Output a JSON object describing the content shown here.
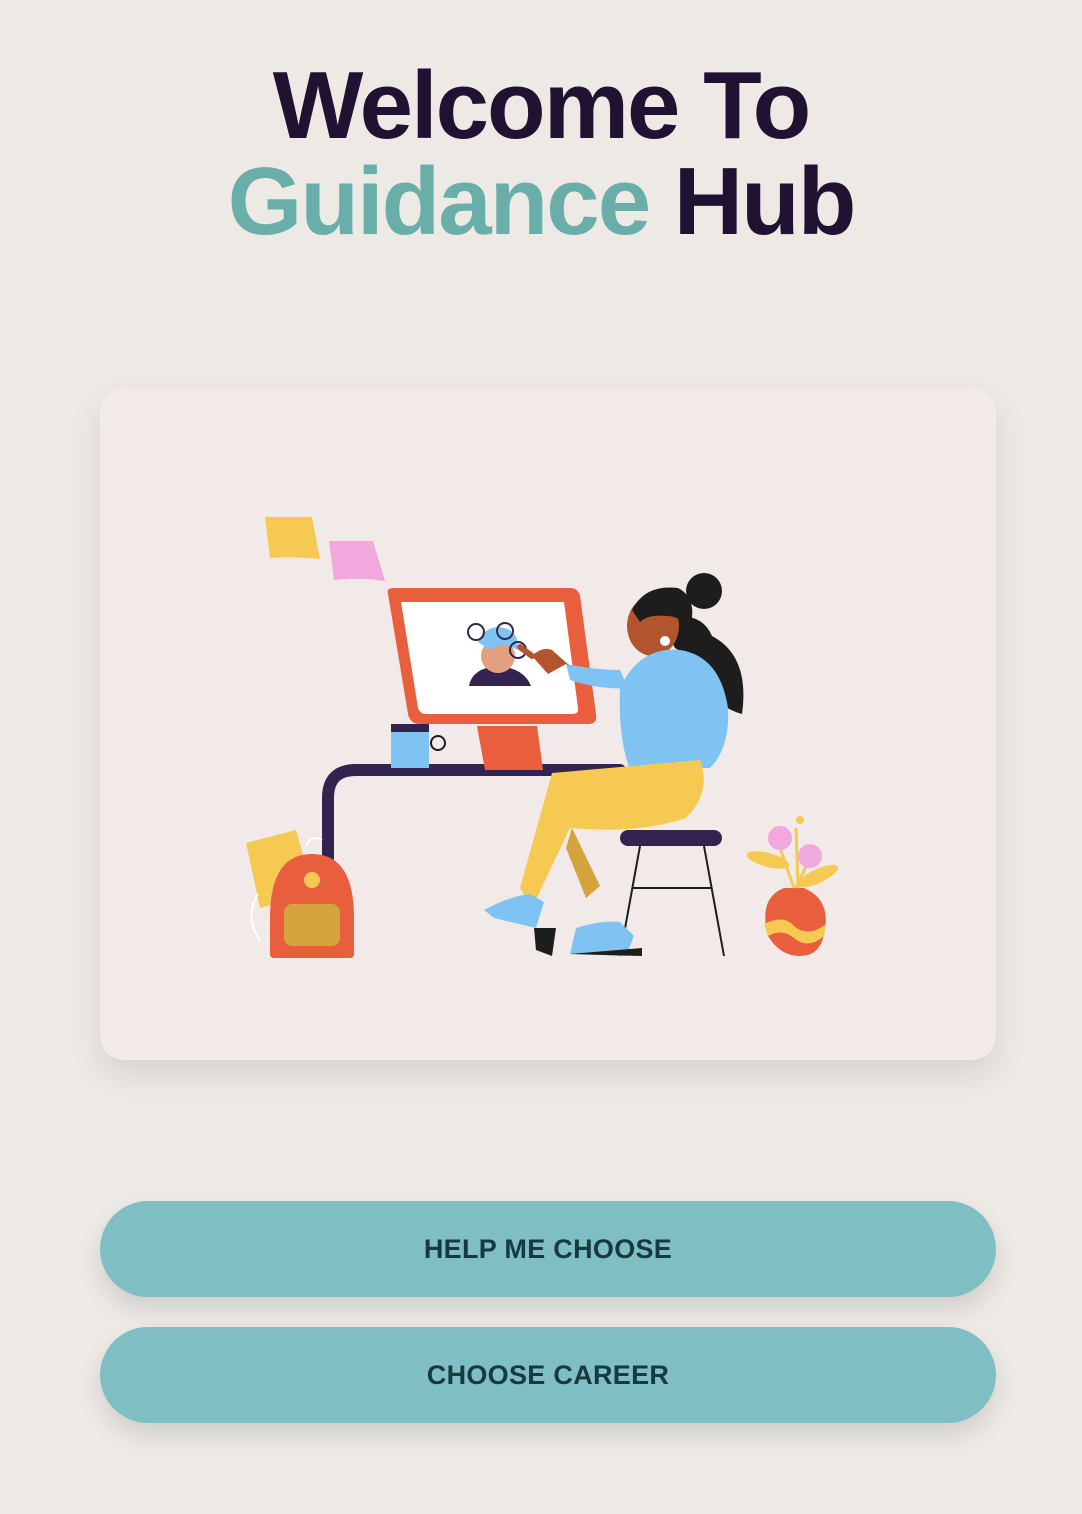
{
  "header": {
    "line1": "Welcome To",
    "accent_word": "Guidance",
    "last_word": "Hub"
  },
  "actions": {
    "help_label": "HELP ME CHOOSE",
    "career_label": "CHOOSE CAREER"
  },
  "colors": {
    "background": "#edeae6",
    "title_dark": "#221232",
    "title_accent": "#6aaeaa",
    "button_fill": "#7fbfc4",
    "button_text": "#173a3e",
    "card_fill": "#f2eae8"
  },
  "illustration": {
    "icon": "woman-at-computer-illustration"
  }
}
